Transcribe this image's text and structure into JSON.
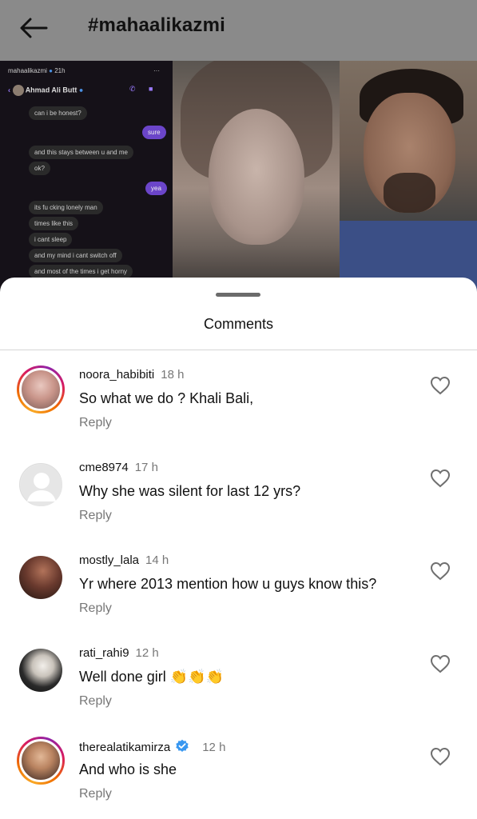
{
  "header": {
    "title": "#mahaalikazmi"
  },
  "media": {
    "chat": {
      "poster": "mahaalikazmi",
      "poster_time": "21h",
      "contact": "Ahmad Ali Butt",
      "messages": [
        {
          "from": "them",
          "text": "can i be honest?"
        },
        {
          "from": "me",
          "text": "sure"
        },
        {
          "from": "them",
          "text": "and this stays between u and me"
        },
        {
          "from": "them",
          "text": "ok?"
        },
        {
          "from": "me",
          "text": "yea"
        },
        {
          "from": "them",
          "text": "its fu cking lonely man"
        },
        {
          "from": "them",
          "text": "times like this"
        },
        {
          "from": "them",
          "text": "i cant sleep"
        },
        {
          "from": "them",
          "text": "and my mind i cant switch off"
        },
        {
          "from": "them",
          "text": "and most of the times i get horny"
        }
      ]
    }
  },
  "sheet": {
    "title": "Comments"
  },
  "comments": [
    {
      "username": "noora_habibiti",
      "time": "18 h",
      "text": "So what we do ? Khali Bali,",
      "reply": "Reply",
      "story_ring": true,
      "verified": false
    },
    {
      "username": "cme8974",
      "time": "17 h",
      "text": "Why she was silent for last 12 yrs?",
      "reply": "Reply",
      "story_ring": false,
      "verified": false
    },
    {
      "username": "mostly_lala",
      "time": "14 h",
      "text": "Yr where 2013 mention how u guys know this?",
      "reply": "Reply",
      "story_ring": false,
      "verified": false
    },
    {
      "username": "rati_rahi9",
      "time": "12 h",
      "text": "Well done girl 👏👏👏",
      "reply": "Reply",
      "story_ring": false,
      "verified": false
    },
    {
      "username": "therealatikamirza",
      "time": "12 h",
      "text": "And who is she",
      "reply": "Reply",
      "story_ring": true,
      "verified": true
    }
  ],
  "icons": {
    "back": "arrow-left-icon",
    "heart": "heart-outline-icon",
    "verified": "verified-badge-icon"
  },
  "colors": {
    "verified": "#3897f0",
    "chat_accent": "#6b45c9"
  }
}
